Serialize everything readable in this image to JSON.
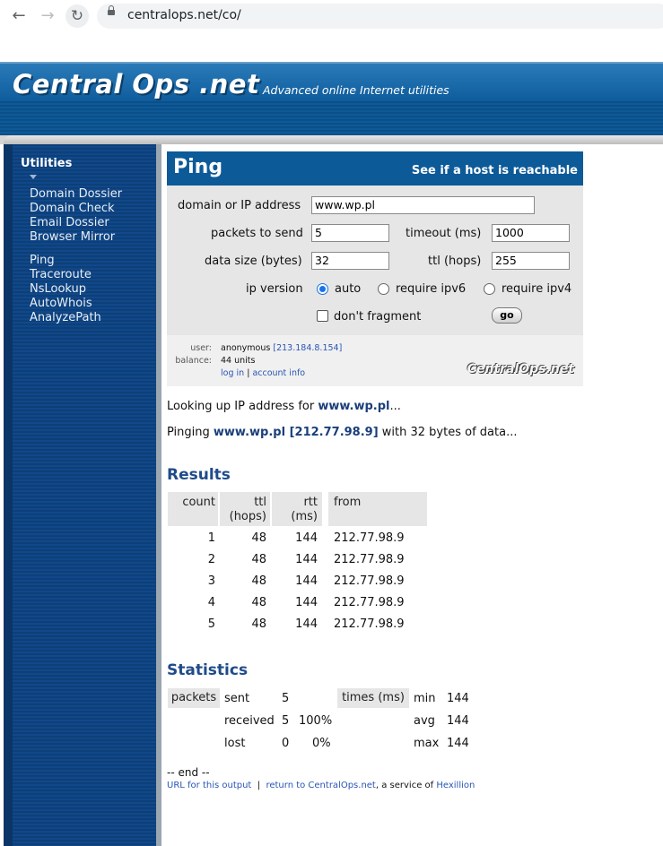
{
  "browser": {
    "url": "centralops.net/co/"
  },
  "header": {
    "logo": "Central Ops .net",
    "tagline": "Advanced online Internet utilities"
  },
  "sidebar": {
    "title": "Utilities",
    "group1": [
      "Domain Dossier",
      "Domain Check",
      "Email Dossier",
      "Browser Mirror"
    ],
    "group2": [
      "Ping",
      "Traceroute",
      "NsLookup",
      "AutoWhois",
      "AnalyzePath"
    ]
  },
  "form": {
    "title": "Ping",
    "subtitle": "See if a host is reachable",
    "domain_label": "domain or IP address",
    "domain_value": "www.wp.pl",
    "packets_label": "packets to send",
    "packets_value": "5",
    "timeout_label": "timeout (ms)",
    "timeout_value": "1000",
    "size_label": "data size (bytes)",
    "size_value": "32",
    "ttl_label": "ttl (hops)",
    "ttl_value": "255",
    "ipver_label": "ip version",
    "opt_auto": "auto",
    "opt_ipv6": "require ipv6",
    "opt_ipv4": "require ipv4",
    "dontfrag_label": "don't fragment",
    "go_label": "go"
  },
  "user": {
    "user_label": "user:",
    "user_value": "anonymous",
    "user_ip": "[213.184.8.154]",
    "balance_label": "balance:",
    "balance_value": "44 units",
    "login": "log in",
    "sep": "|",
    "account": "account info",
    "logo": "CentralOps.net"
  },
  "output": {
    "lookup_prefix": "Looking up IP address for ",
    "lookup_host": "www.wp.pl",
    "lookup_suffix": "...",
    "ping_prefix": "Pinging ",
    "ping_host": "www.wp.pl [212.77.98.9]",
    "ping_suffix": " with 32 bytes of data..."
  },
  "results": {
    "heading": "Results",
    "col_count": "count",
    "col_ttl_1": "ttl",
    "col_ttl_2": "(hops)",
    "col_rtt_1": "rtt",
    "col_rtt_2": "(ms)",
    "col_from": "from",
    "rows": [
      {
        "count": "1",
        "ttl": "48",
        "rtt": "144",
        "from": "212.77.98.9"
      },
      {
        "count": "2",
        "ttl": "48",
        "rtt": "144",
        "from": "212.77.98.9"
      },
      {
        "count": "3",
        "ttl": "48",
        "rtt": "144",
        "from": "212.77.98.9"
      },
      {
        "count": "4",
        "ttl": "48",
        "rtt": "144",
        "from": "212.77.98.9"
      },
      {
        "count": "5",
        "ttl": "48",
        "rtt": "144",
        "from": "212.77.98.9"
      }
    ]
  },
  "statistics": {
    "heading": "Statistics",
    "packets": "packets",
    "sent": "sent",
    "sent_value": "5",
    "received": "received",
    "received_value": "5",
    "received_pct": "100%",
    "lost": "lost",
    "lost_value": "0",
    "lost_pct": "0%",
    "times": "times (ms)",
    "min": "min",
    "min_value": "144",
    "avg": "avg",
    "avg_value": "144",
    "max": "max",
    "max_value": "144"
  },
  "footer": {
    "end": "-- end --",
    "url_link": "URL for this output",
    "sep": "|",
    "return_link": "return to CentralOps.net",
    "service_text": ", a service of ",
    "hexillion": "Hexillion"
  },
  "colors": {
    "brand_blue": "#0d5a98",
    "link": "#2a55b5",
    "heading": "#1f4b8a"
  }
}
